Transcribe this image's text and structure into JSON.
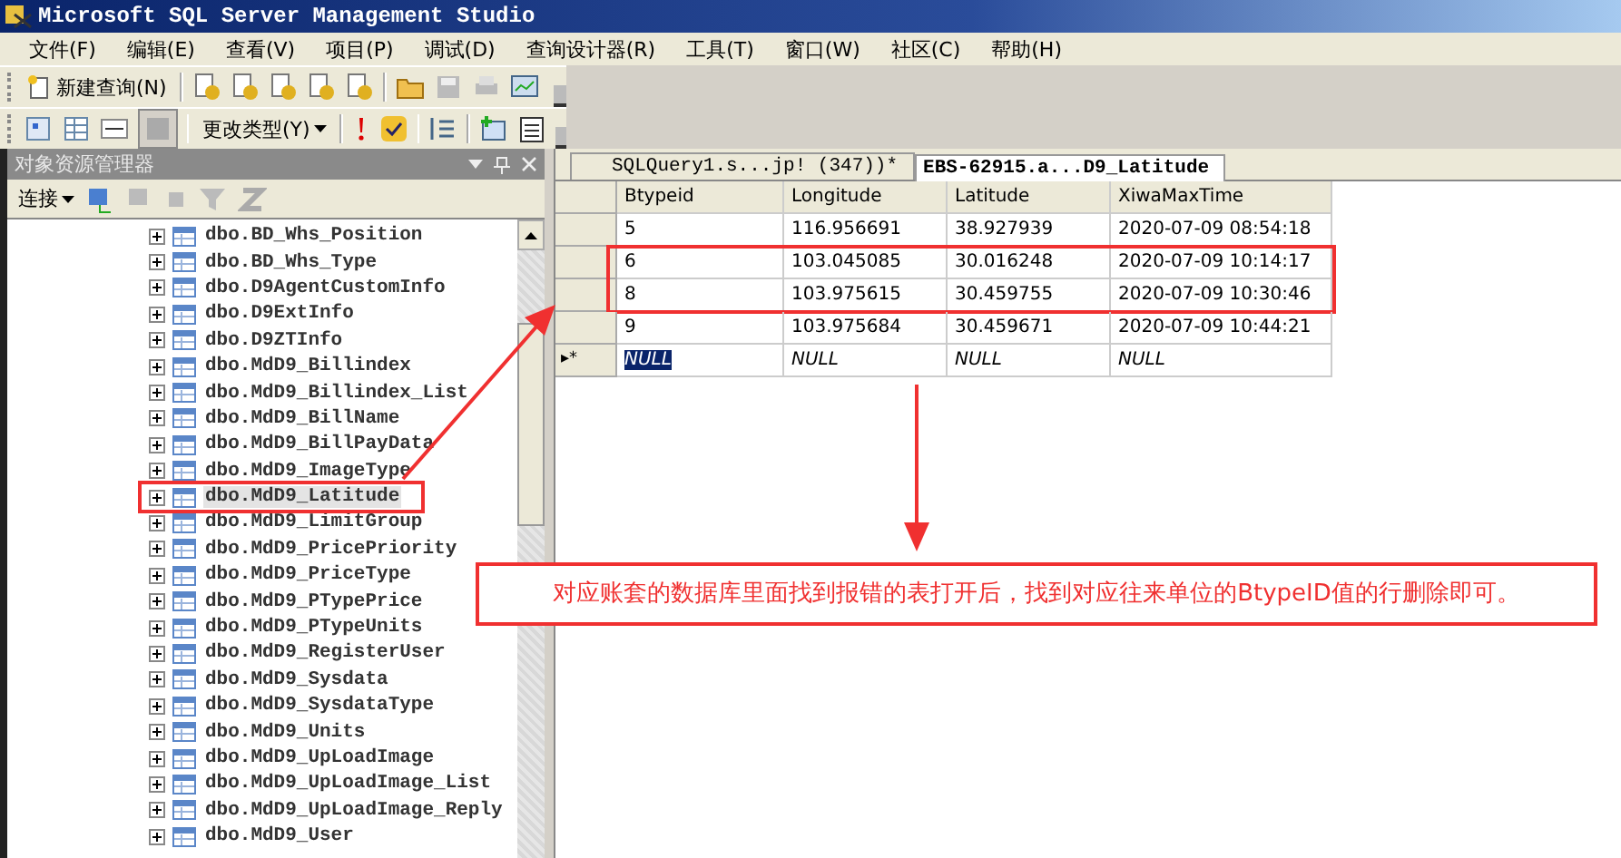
{
  "window": {
    "title": "Microsoft SQL Server Management Studio"
  },
  "menu": [
    "文件(F)",
    "编辑(E)",
    "查看(V)",
    "项目(P)",
    "调试(D)",
    "查询设计器(R)",
    "工具(T)",
    "窗口(W)",
    "社区(C)",
    "帮助(H)"
  ],
  "toolbar": {
    "new_query": "新建查询(N)",
    "change_type": "更改类型(Y)"
  },
  "object_explorer": {
    "title": "对象资源管理器",
    "connect": "连接",
    "items": [
      {
        "name": "dbo.BD_Whs_Position",
        "highlighted": false
      },
      {
        "name": "dbo.BD_Whs_Type",
        "highlighted": false
      },
      {
        "name": "dbo.D9AgentCustomInfo",
        "highlighted": false
      },
      {
        "name": "dbo.D9ExtInfo",
        "highlighted": false
      },
      {
        "name": "dbo.D9ZTInfo",
        "highlighted": false
      },
      {
        "name": "dbo.MdD9_Billindex",
        "highlighted": false
      },
      {
        "name": "dbo.MdD9_Billindex_List",
        "highlighted": false
      },
      {
        "name": "dbo.MdD9_BillName",
        "highlighted": false
      },
      {
        "name": "dbo.MdD9_BillPayData",
        "highlighted": false
      },
      {
        "name": "dbo.MdD9_ImageType",
        "highlighted": false
      },
      {
        "name": "dbo.MdD9_Latitude",
        "highlighted": true
      },
      {
        "name": "dbo.MdD9_LimitGroup",
        "highlighted": false
      },
      {
        "name": "dbo.MdD9_PricePriority",
        "highlighted": false
      },
      {
        "name": "dbo.MdD9_PriceType",
        "highlighted": false
      },
      {
        "name": "dbo.MdD9_PTypePrice",
        "highlighted": false
      },
      {
        "name": "dbo.MdD9_PTypeUnits",
        "highlighted": false
      },
      {
        "name": "dbo.MdD9_RegisterUser",
        "highlighted": false
      },
      {
        "name": "dbo.MdD9_Sysdata",
        "highlighted": false
      },
      {
        "name": "dbo.MdD9_SysdataType",
        "highlighted": false
      },
      {
        "name": "dbo.MdD9_Units",
        "highlighted": false
      },
      {
        "name": "dbo.MdD9_UpLoadImage",
        "highlighted": false
      },
      {
        "name": "dbo.MdD9_UpLoadImage_List",
        "highlighted": false
      },
      {
        "name": "dbo.MdD9_UpLoadImage_Reply",
        "highlighted": false
      },
      {
        "name": "dbo.MdD9_User",
        "highlighted": false
      }
    ]
  },
  "tabs": [
    {
      "label": "SQLQuery1.s...jp! (347))*",
      "selected": false
    },
    {
      "label": "EBS-62915.a...D9_Latitude",
      "selected": true
    }
  ],
  "table": {
    "columns": [
      "Btypeid",
      "Longitude",
      "Latitude",
      "XiwaMaxTime"
    ],
    "rows": [
      {
        "cells": [
          "5",
          "116.956691",
          "38.927939",
          "2020-07-09 08:54:18"
        ],
        "highlighted": false
      },
      {
        "cells": [
          "6",
          "103.045085",
          "30.016248",
          "2020-07-09 10:14:17"
        ],
        "highlighted": true
      },
      {
        "cells": [
          "8",
          "103.975615",
          "30.459755",
          "2020-07-09 10:30:46"
        ],
        "highlighted": true
      },
      {
        "cells": [
          "9",
          "103.975684",
          "30.459671",
          "2020-07-09 10:44:21"
        ],
        "highlighted": false
      }
    ],
    "new_row": {
      "marker": "▸*",
      "cells": [
        "NULL",
        "NULL",
        "NULL",
        "NULL"
      ]
    }
  },
  "annotation": {
    "text": "对应账套的数据库里面找到报错的表打开后，找到对应往来单位的BtypeID值的行删除即可。"
  }
}
